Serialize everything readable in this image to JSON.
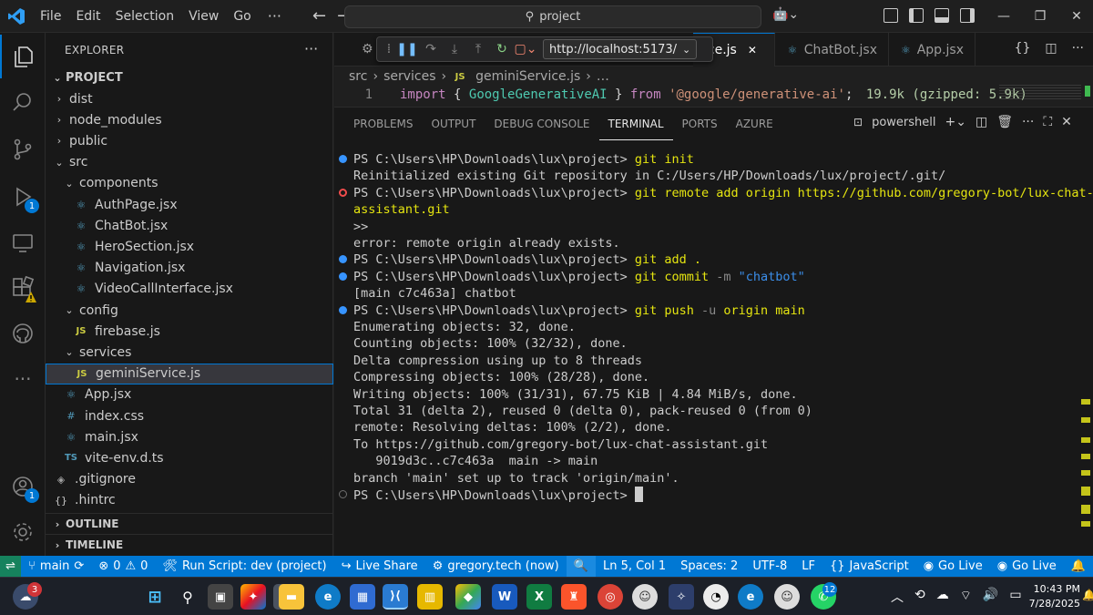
{
  "titlebar": {
    "menu": [
      "File",
      "Edit",
      "Selection",
      "View",
      "Go"
    ],
    "more": "···",
    "search": "project"
  },
  "activity": {
    "debug_badge": "1",
    "accounts_badge": "1"
  },
  "sidebar": {
    "title": "EXPLORER",
    "more": "···",
    "root": "PROJECT",
    "items": [
      {
        "label": "dist",
        "type": "folder",
        "expanded": false
      },
      {
        "label": "node_modules",
        "type": "folder",
        "expanded": false
      },
      {
        "label": "public",
        "type": "folder",
        "expanded": false
      },
      {
        "label": "src",
        "type": "folder",
        "expanded": true
      },
      {
        "label": "components",
        "type": "folder",
        "expanded": true
      },
      {
        "label": "AuthPage.jsx",
        "type": "jsx"
      },
      {
        "label": "ChatBot.jsx",
        "type": "jsx"
      },
      {
        "label": "HeroSection.jsx",
        "type": "jsx"
      },
      {
        "label": "Navigation.jsx",
        "type": "jsx"
      },
      {
        "label": "VideoCallInterface.jsx",
        "type": "jsx"
      },
      {
        "label": "config",
        "type": "folder",
        "expanded": true
      },
      {
        "label": "firebase.js",
        "type": "js",
        "icon": "JS"
      },
      {
        "label": "services",
        "type": "folder",
        "expanded": true
      },
      {
        "label": "geminiService.js",
        "type": "js",
        "icon": "JS",
        "selected": true
      },
      {
        "label": "App.jsx",
        "type": "jsx"
      },
      {
        "label": "index.css",
        "type": "css",
        "icon": "#"
      },
      {
        "label": "main.jsx",
        "type": "jsx"
      },
      {
        "label": "vite-env.d.ts",
        "type": "ts",
        "icon": "TS"
      },
      {
        "label": ".gitignore",
        "type": "git"
      },
      {
        "label": ".hintrc",
        "type": "json",
        "icon": "{}"
      }
    ],
    "outline": "OUTLINE",
    "timeline": "TIMELINE"
  },
  "editor": {
    "tabs": [
      {
        "label": "ice.js",
        "active": true
      },
      {
        "label": "ChatBot.jsx",
        "active": false
      },
      {
        "label": "App.jsx",
        "active": false
      }
    ],
    "debug_url": "http://localhost:5173/",
    "breadcrumb": {
      "parts": [
        "src",
        "services"
      ],
      "file_icon": "JS",
      "file": "geminiService.js",
      "tail": "…"
    },
    "line_number": "1",
    "code": {
      "import": "import",
      "open": "{",
      "name": "GoogleGenerativeAI",
      "close": "}",
      "from": "from",
      "module": "'@google/generative-ai'",
      "semi": ";",
      "size_hint": "19.9k (gzipped: 5.9k)"
    }
  },
  "panel": {
    "tabs": [
      "PROBLEMS",
      "OUTPUT",
      "DEBUG CONSOLE",
      "TERMINAL",
      "PORTS",
      "AZURE"
    ],
    "active_tab": "TERMINAL",
    "shell": "powershell"
  },
  "terminal": {
    "prompt": "PS C:\\Users\\HP\\Downloads\\lux\\project> ",
    "lines": [
      {
        "kind": "cmd",
        "status": "ok",
        "parts": [
          {
            "t": "git init",
            "c": "cmd"
          }
        ]
      },
      {
        "kind": "out",
        "text": "Reinitialized existing Git repository in C:/Users/HP/Downloads/lux/project/.git/"
      },
      {
        "kind": "cmd",
        "status": "err",
        "parts": [
          {
            "t": "git remote add origin https://github.com/gregory-bot/lux-chat-",
            "c": "cmd"
          }
        ]
      },
      {
        "kind": "out",
        "text": "assistant.git",
        "c": "cmd"
      },
      {
        "kind": "out",
        "text": ">>"
      },
      {
        "kind": "out",
        "text": "error: remote origin already exists."
      },
      {
        "kind": "cmd",
        "status": "ok",
        "parts": [
          {
            "t": "git add .",
            "c": "cmd"
          }
        ]
      },
      {
        "kind": "cmd",
        "status": "ok",
        "parts": [
          {
            "t": "git commit ",
            "c": "cmd"
          },
          {
            "t": "-m ",
            "c": "flag"
          },
          {
            "t": "\"chatbot\"",
            "c": "tstr"
          }
        ]
      },
      {
        "kind": "out",
        "text": "[main c7c463a] chatbot"
      },
      {
        "kind": "cmd",
        "status": "ok",
        "parts": [
          {
            "t": "git push ",
            "c": "cmd"
          },
          {
            "t": "-u ",
            "c": "flag"
          },
          {
            "t": "origin main",
            "c": "cmd"
          }
        ]
      },
      {
        "kind": "out",
        "text": "Enumerating objects: 32, done."
      },
      {
        "kind": "out",
        "text": "Counting objects: 100% (32/32), done."
      },
      {
        "kind": "out",
        "text": "Delta compression using up to 8 threads"
      },
      {
        "kind": "out",
        "text": "Compressing objects: 100% (28/28), done."
      },
      {
        "kind": "out",
        "text": "Writing objects: 100% (31/31), 67.75 KiB | 4.84 MiB/s, done."
      },
      {
        "kind": "out",
        "text": "Total 31 (delta 2), reused 0 (delta 0), pack-reused 0 (from 0)"
      },
      {
        "kind": "out",
        "text": "remote: Resolving deltas: 100% (2/2), done."
      },
      {
        "kind": "out",
        "text": "To https://github.com/gregory-bot/lux-chat-assistant.git"
      },
      {
        "kind": "out",
        "text": "   9019d3c..c7c463a  main -> main"
      },
      {
        "kind": "out",
        "text": "branch 'main' set up to track 'origin/main'."
      },
      {
        "kind": "cmd",
        "status": "idle",
        "parts": [],
        "cursor": true
      }
    ]
  },
  "statusbar": {
    "branch": "main",
    "errors": "0",
    "warnings": "0",
    "run_script": "Run Script: dev (project)",
    "live_share": "Live Share",
    "account": "gregory.tech (now)",
    "position": "Ln 5, Col 1",
    "spaces": "Spaces: 2",
    "encoding": "UTF-8",
    "eol": "LF",
    "language": "JavaScript",
    "go_live_1": "Go Live",
    "go_live_2": "Go Live"
  },
  "taskbar": {
    "start_badge": "3",
    "whatsapp_badge": "12",
    "time": "10:43 PM",
    "date": "7/28/2025"
  },
  "colors": {
    "accent": "#0078d4",
    "statusbar": "#0078d4",
    "terminal_command": "#e5e510",
    "terminal_string": "#3b8eea",
    "error": "#f14c4c"
  }
}
